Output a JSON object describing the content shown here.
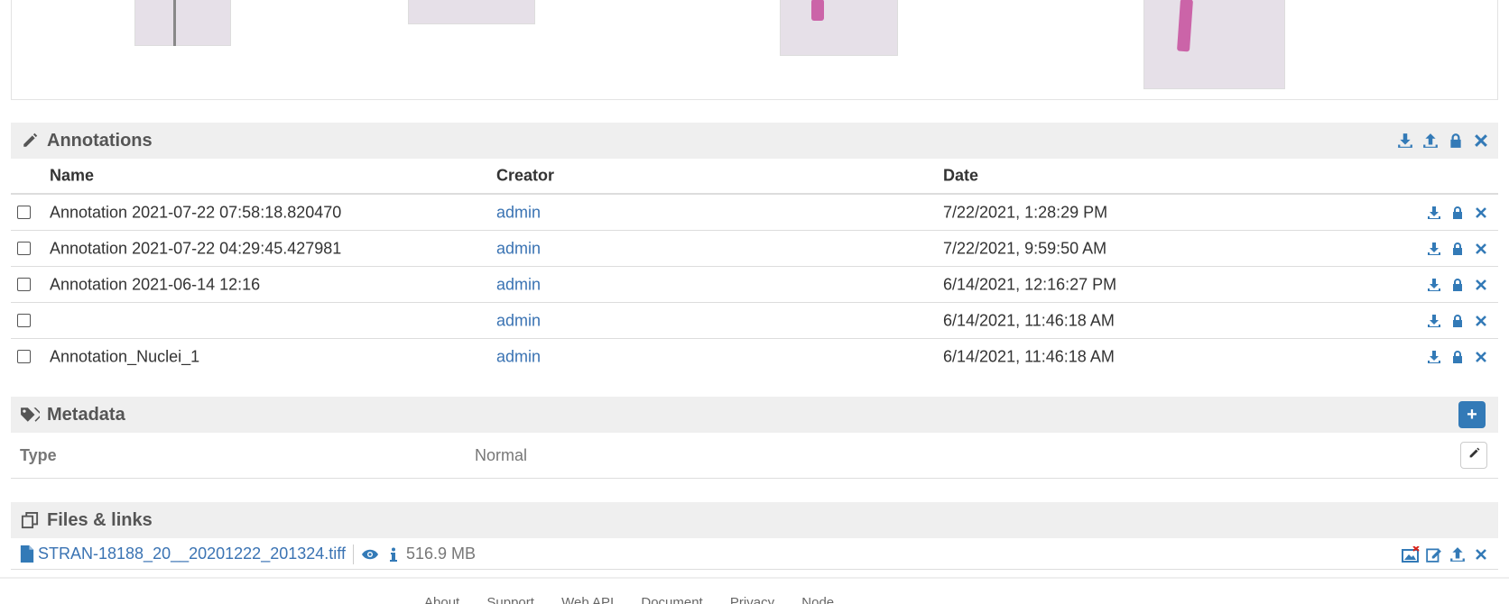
{
  "annotations": {
    "title": "Annotations",
    "columns": {
      "name": "Name",
      "creator": "Creator",
      "date": "Date"
    },
    "rows": [
      {
        "name": "Annotation 2021-07-22 07:58:18.820470",
        "creator": "admin",
        "date": "7/22/2021, 1:28:29 PM"
      },
      {
        "name": "Annotation 2021-07-22 04:29:45.427981",
        "creator": "admin",
        "date": "7/22/2021, 9:59:50 AM"
      },
      {
        "name": "Annotation 2021-06-14 12:16",
        "creator": "admin",
        "date": "6/14/2021, 12:16:27 PM"
      },
      {
        "name": "",
        "creator": "admin",
        "date": "6/14/2021, 11:46:18 AM"
      },
      {
        "name": "Annotation_Nuclei_1",
        "creator": "admin",
        "date": "6/14/2021, 11:46:18 AM"
      }
    ]
  },
  "metadata": {
    "title": "Metadata",
    "key": "Type",
    "value": "Normal",
    "add_label": "+"
  },
  "files": {
    "title": "Files & links",
    "file_name": "STRAN-18188_20__20201222_201324.tiff",
    "file_size": "516.9 MB"
  },
  "footer": {
    "links": [
      "About",
      "Support",
      "Web API",
      "Document",
      "Privacy",
      "Node"
    ]
  },
  "colors": {
    "accent": "#337ab7",
    "link": "#3a73b3",
    "header_bg": "#efefef",
    "tissue": "#c64e9c"
  }
}
